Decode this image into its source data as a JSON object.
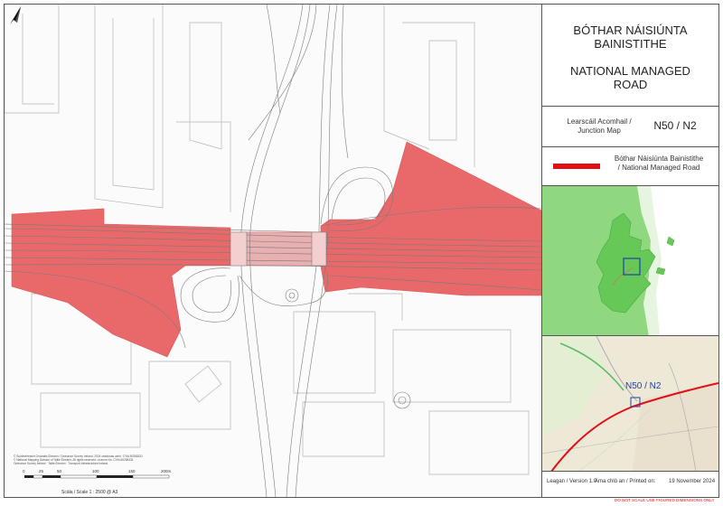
{
  "map": {
    "highlight_color": "#e9696b",
    "road_colors": {
      "line": "#777777",
      "light_line": "#aaaaaa"
    }
  },
  "panel": {
    "title_irish_line1": "BÓTHAR NÁISIÚNTA",
    "title_irish_line2": "BAINISTITHE",
    "title_english_line1": "NATIONAL MANAGED",
    "title_english_line2": "ROAD",
    "junction_label_line1": "Learscáil Acomhail /",
    "junction_label_line2": "Junction  Map",
    "junction_code": "N50 / N2",
    "legend_swatch_color": "#e20e15",
    "legend_text_line1": "Bóthar Náisiúnta Bainistithe",
    "legend_text_line2": "/ National Managed Road",
    "locator_colors": {
      "sea": "#ffffff",
      "land": "#90d880",
      "county": "#65c857",
      "box": "#1f3fae"
    },
    "inset_label": "N50 / N2",
    "version": "Leagan / Version 1.0",
    "printed_label": "Ama chlò an / Printed on:",
    "printed_date": "19 November 2024"
  },
  "disclaimer": "DO NOT SCALE USE FIGURED DIMENSIONS ONLY",
  "copyright": [
    "© Suirbhéireacht Ordanáis Éireann / Ordnance Survey Ireland, 2024 ceadúnas uimh. CYAL50268331",
    "© National Mapping Division of Tailte Éireann, All rights reserved. Licence No. CYAL50268331",
    "Ordnance Survey Ireland · Tailte Éireann · Transport Infrastructure Ireland"
  ],
  "scale": {
    "ticks": [
      "0",
      "25",
      "50",
      "100",
      "150",
      "200m"
    ],
    "caption": "Scála / Scale 1 : 2500 @ A3"
  }
}
